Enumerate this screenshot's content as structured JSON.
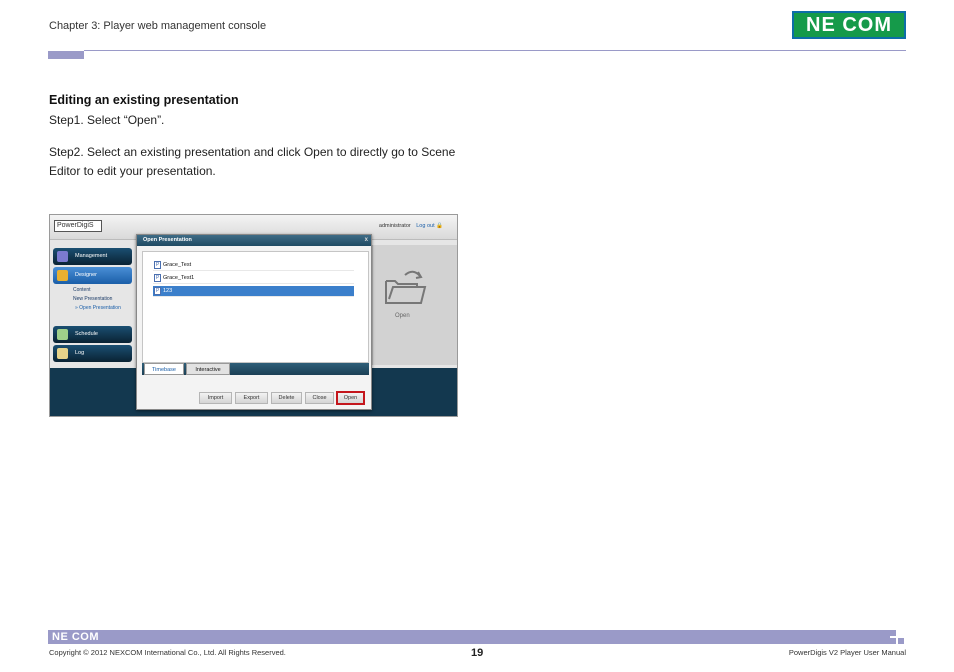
{
  "header": {
    "chapter_title": "Chapter 3: Player web management console",
    "logo_text": "NE COM"
  },
  "content": {
    "section_heading": "Editing an existing presentation",
    "step1": "Step1. Select “Open”.",
    "step2": "Step2. Select an existing presentation and click Open to directly go to Scene Editor to edit your presentation."
  },
  "screenshot": {
    "app_logo": "PowerDigiS",
    "user": "administrator",
    "logout": "Log out",
    "sidebar": {
      "management": "Management",
      "designer": "Designer",
      "sub_items": [
        "Content",
        "New Presentation",
        "» Open Presentation"
      ],
      "schedule": "Schedule",
      "log": "Log"
    },
    "right_panel_label": "Open",
    "dialog": {
      "title": "Open Presentation",
      "close": "x",
      "items": [
        "Grace_Test",
        "Grace_Test1",
        "123"
      ],
      "selected_index": 2,
      "tabs": [
        "Timebase",
        "Interactive"
      ],
      "buttons": [
        "Import",
        "Export",
        "Delete",
        "Close",
        "Open"
      ]
    }
  },
  "footer": {
    "logo_text": "NE COM",
    "copyright": "Copyright © 2012 NEXCOM International Co., Ltd. All Rights Reserved.",
    "page_number": "19",
    "manual_title": "PowerDigis V2 Player User Manual"
  },
  "colors": {
    "brand_green": "#159a4a",
    "rule_purple": "#9a9ac8",
    "highlight_red": "#c4161c",
    "selection_blue": "#3b7fcb"
  }
}
